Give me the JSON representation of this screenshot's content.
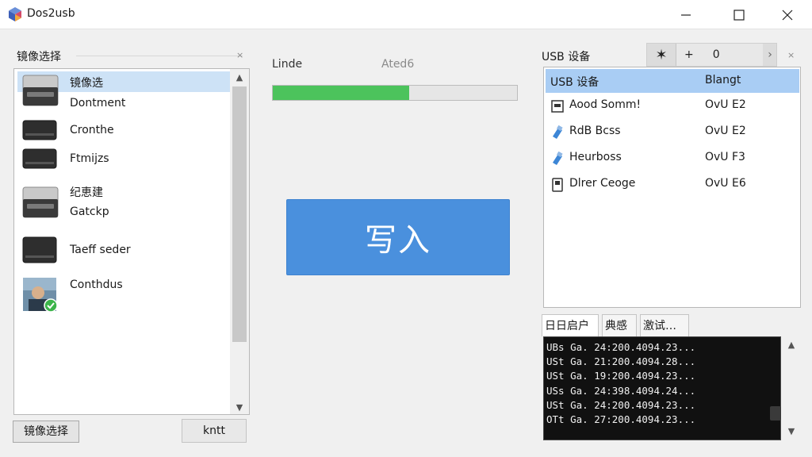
{
  "window": {
    "title": "Dos2usb",
    "icon": "app-cube-icon",
    "controls": {
      "minimize": "—",
      "maximize": "☐",
      "close": "✕"
    }
  },
  "left_panel": {
    "title": "镜像选择",
    "corner_x": "×",
    "items": [
      {
        "label": "镜像选",
        "label2": "Dontment",
        "icon": "drive-silver-icon",
        "selected": true
      },
      {
        "label": "Cronthe",
        "icon": "drive-black-icon"
      },
      {
        "label": "Ftmijzs",
        "icon": "drive-black-icon"
      },
      {
        "label": "纪恵建",
        "label2": "Gatckp",
        "icon": "drive-silver-icon"
      },
      {
        "label": "Taeff seder",
        "icon": "drive-black-icon"
      },
      {
        "label": "Conthdus",
        "icon": "user-photo-icon"
      }
    ],
    "button_select": "镜像选择",
    "button_other": "kntt"
  },
  "middle": {
    "label_left": "Linde",
    "label_right": "Ated6",
    "progress_percent": 56,
    "write_button": "写入"
  },
  "right_panel": {
    "title": "USB 设备",
    "corner_x": "×",
    "toolbar": {
      "star": "✶",
      "plus": "+",
      "count": "0",
      "arrow": "›"
    },
    "header": {
      "name": "USB 设备",
      "col2": "Blangt"
    },
    "devices": [
      {
        "name": "Aood Somm!",
        "value": "OvU E2",
        "icon": "drive-small-icon"
      },
      {
        "name": "RdB Bcss",
        "value": "OvU E2",
        "icon": "usb-blue-icon"
      },
      {
        "name": "Heurboss",
        "value": "OvU F3",
        "icon": "usb-blue-icon"
      },
      {
        "name": "Dlrer Ceoge",
        "value": "OvU E6",
        "icon": "drive-outline-icon"
      }
    ],
    "tabs": [
      "日日启户",
      "典感",
      "激试…"
    ],
    "log_lines": [
      "UBs Ga. 24:200.4094.23...",
      "USt Ga. 21:200.4094.28...",
      "USt Ga. 19:200.4094.23...",
      "USs Ga. 24:398.4094.24...",
      "USt Ga. 24:200.4094.23...",
      "OTt Ga. 27:200.4094.23..."
    ]
  }
}
